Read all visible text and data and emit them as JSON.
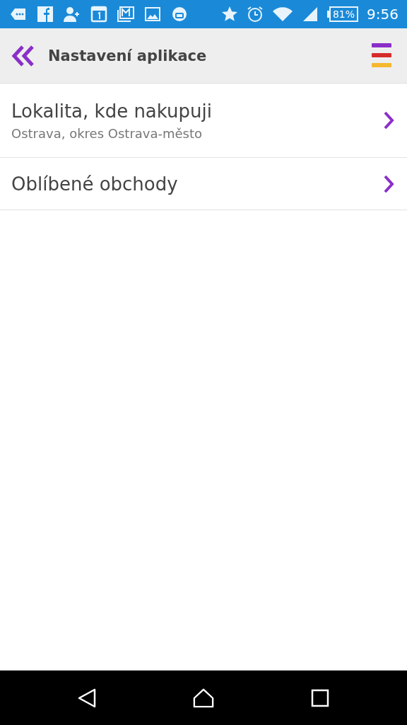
{
  "status_bar": {
    "battery": "81%",
    "time": "9:56"
  },
  "header": {
    "title": "Nastavení aplikace"
  },
  "items": [
    {
      "title": "Lokalita, kde nakupuji",
      "subtitle": "Ostrava, okres Ostrava-město"
    },
    {
      "title": "Oblíbené obchody"
    }
  ]
}
